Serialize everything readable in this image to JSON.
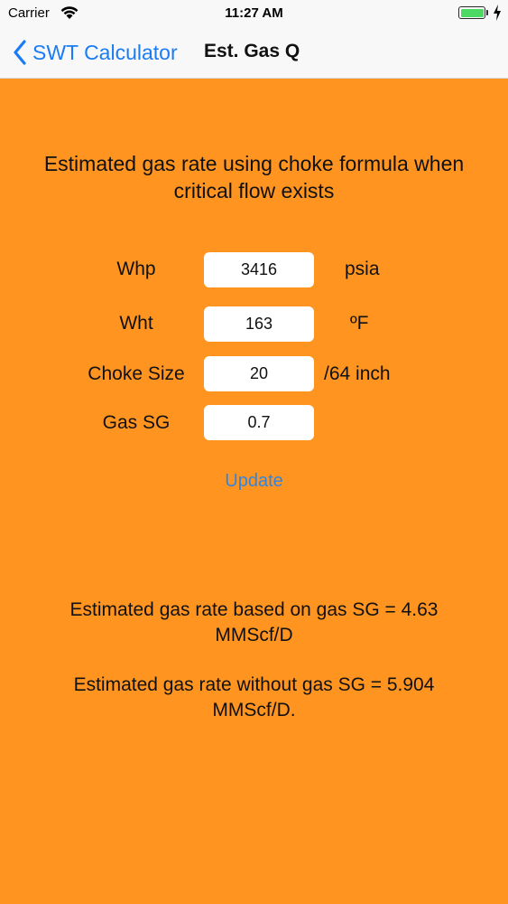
{
  "status_bar": {
    "carrier": "Carrier",
    "time": "11:27 AM",
    "battery_color": "#4cd964"
  },
  "nav": {
    "back_label": "SWT Calculator",
    "title": "Est. Gas Q",
    "accent_color": "#1a7cf5"
  },
  "main": {
    "background_color": "#ff9420",
    "heading": "Estimated gas rate using choke formula when critical flow exists",
    "fields": [
      {
        "label": "Whp",
        "value": "3416",
        "unit": "psia"
      },
      {
        "label": "Wht",
        "value": "163",
        "unit": "ºF"
      },
      {
        "label": "Choke Size",
        "value": "20",
        "unit": "/64 inch"
      },
      {
        "label": "Gas SG",
        "value": "0.7",
        "unit": ""
      }
    ],
    "update_label": "Update",
    "results": {
      "with_sg": "Estimated gas rate based on gas SG = 4.63 MMScf/D",
      "without_sg": "Estimated gas rate without gas SG = 5.904 MMScf/D."
    }
  }
}
